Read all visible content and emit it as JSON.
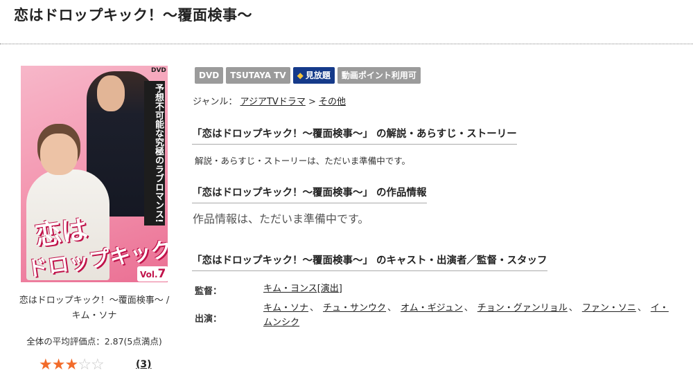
{
  "title": "恋はドロップキック！～覆面検事～",
  "cover": {
    "catch_copy": "予想不可能な究極のラブロマンス!",
    "logo_line1": "恋は",
    "logo_line2": "ドロップキック!",
    "vol_label": "Vol.",
    "vol_number": "7",
    "dvd_mark": "DVD"
  },
  "caption": "恋はドロップキック！～覆面検事～ / キム・ソナ",
  "rating": {
    "average_text": "全体の平均評価点：2.87(5点満点)",
    "stars_filled": 3,
    "stars_total": 5,
    "review_count": "(3)"
  },
  "badges": {
    "dvd": "DVD",
    "tsutaya_tv": "TSUTAYA TV",
    "mihoudai": "見放題",
    "douga_point": "動画ポイント利用可"
  },
  "genre": {
    "label": "ジャンル：",
    "primary": "アジアTVドラマ",
    "separator": ">",
    "secondary": "その他"
  },
  "story": {
    "heading": "「恋はドロップキック！～覆面検事～」 の解説・あらすじ・ストーリー",
    "text": "解説・あらすじ・ストーリーは、ただいま準備中です。"
  },
  "info": {
    "heading": "「恋はドロップキック！～覆面検事～」 の作品情報",
    "text": "作品情報は、ただいま準備中です。"
  },
  "cast": {
    "heading": "「恋はドロップキック！～覆面検事～」 のキャスト・出演者／監督・スタッフ",
    "director_label": "監督：",
    "director": "キム・ヨンス[演出]",
    "cast_label": "出演：",
    "members": [
      "キム・ソナ",
      "チュ・サンウク",
      "オム・ギジュン",
      "チョン・グァンリョル",
      "ファン・ソニ",
      "イ・ムンシク"
    ],
    "separator": "、"
  },
  "colors": {
    "star_on": "#f26b2a",
    "star_off": "#c7c7c7",
    "badge_gray": "#9b9b9b",
    "badge_blue": "#153a8a"
  }
}
